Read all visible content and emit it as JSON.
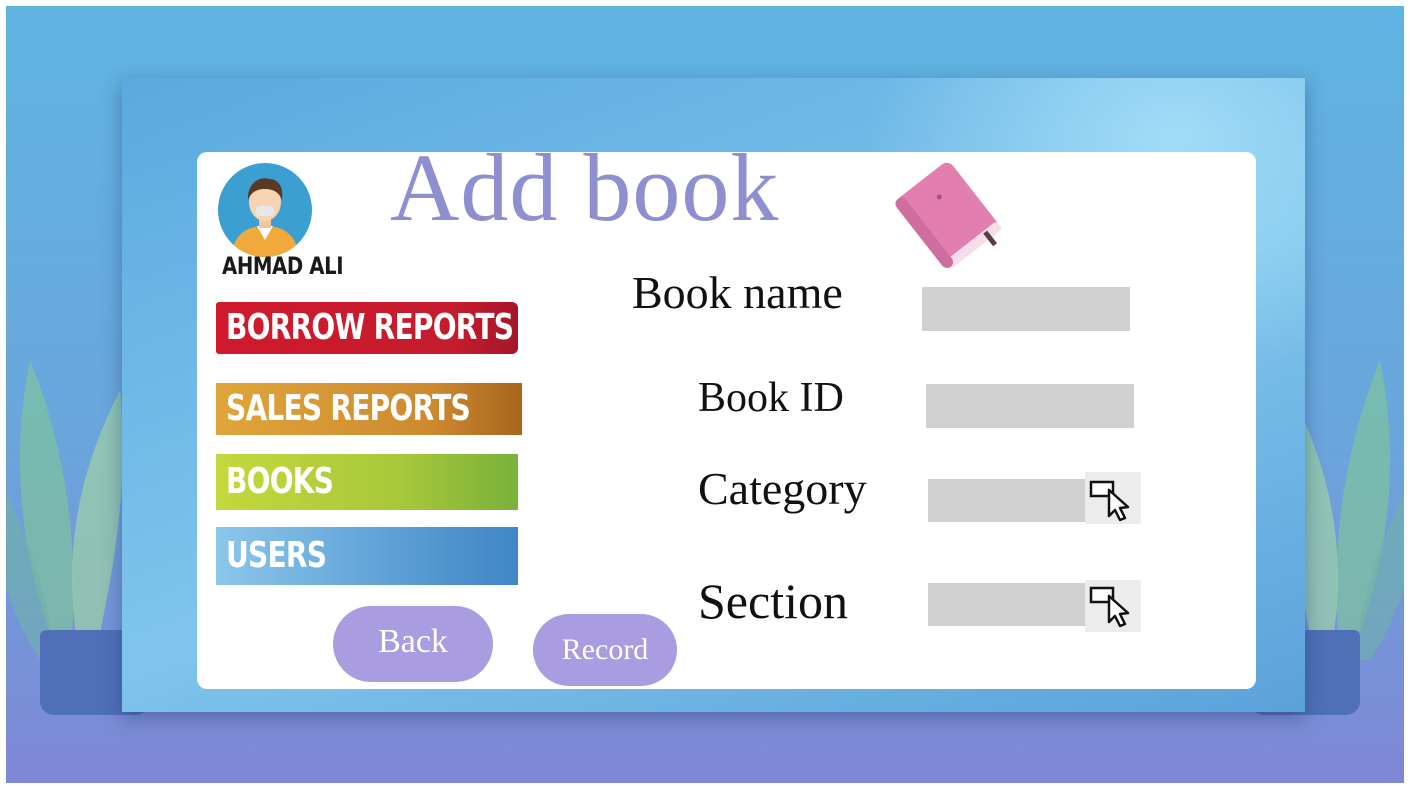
{
  "page": {
    "title": "Add book"
  },
  "user": {
    "name": "AHMAD ALI"
  },
  "nav": {
    "borrow_reports": "BORROW REPORTS",
    "sales_reports": "SALES REPORTS",
    "books": "BOOKS",
    "users": "USERS"
  },
  "actions": {
    "back": "Back",
    "record": "Record"
  },
  "form": {
    "book_name": {
      "label": "Book name",
      "value": ""
    },
    "book_id": {
      "label": "Book ID",
      "value": ""
    },
    "category": {
      "label": "Category",
      "value": ""
    },
    "section": {
      "label": "Section",
      "value": ""
    }
  },
  "colors": {
    "title": "#8e8fd0",
    "borrow": "#d01a2d",
    "sales": "#d69a36",
    "books": "#b6cf3b",
    "users": "#5c9fd5",
    "pill": "#a99ce0",
    "field": "#d0d0d0"
  },
  "icons": {
    "avatar": "user-avatar-icon",
    "book": "pink-book-icon",
    "dropdown": "pointer-cursor-icon"
  }
}
